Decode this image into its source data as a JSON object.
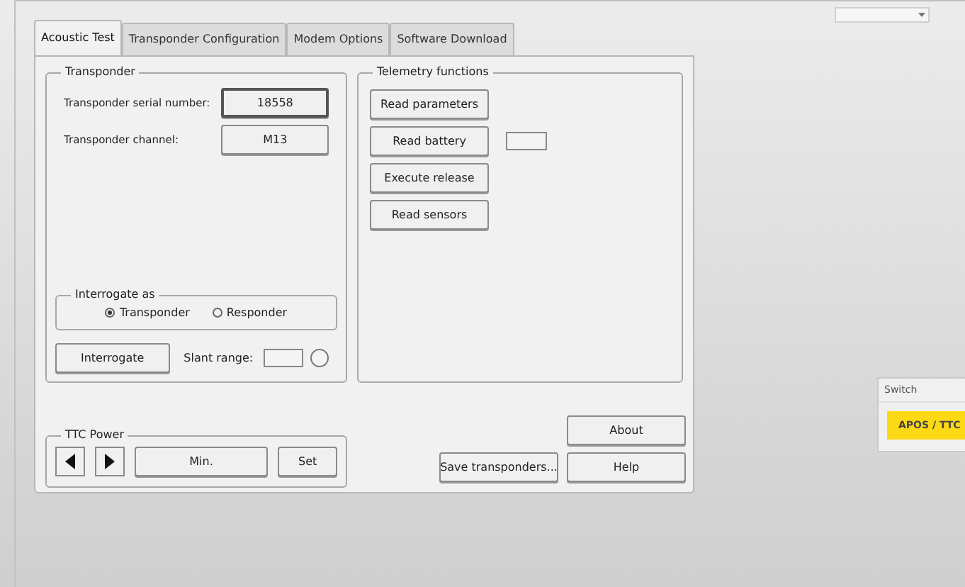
{
  "tabs": [
    {
      "label": "Acoustic Test",
      "selected": true
    },
    {
      "label": "Transponder Configuration",
      "selected": false
    },
    {
      "label": "Modem Options",
      "selected": false
    },
    {
      "label": "Software Download",
      "selected": false
    }
  ],
  "transponder": {
    "title": "Transponder",
    "fields": [
      {
        "label": "Transponder serial number:",
        "value": "18558",
        "focused": true
      },
      {
        "label": "Transponder channel:",
        "value": "M13",
        "focused": false
      }
    ]
  },
  "interrogate_as": {
    "title": "Interrogate as",
    "options": [
      {
        "label": "Transponder",
        "selected": true
      },
      {
        "label": "Responder",
        "selected": false
      }
    ]
  },
  "interrogate_button": "Interrogate",
  "slant_range": {
    "label": "Slant range:"
  },
  "telemetry": {
    "title": "Telemetry functions",
    "buttons": [
      {
        "label": "Read parameters",
        "kind": "button"
      },
      {
        "label": "Read battery",
        "kind": "button_with_output"
      },
      {
        "label": "Execute release",
        "kind": "button"
      },
      {
        "label": "Read sensors",
        "kind": "button"
      }
    ]
  },
  "ttc_power": {
    "title": "TTC Power",
    "value": "Min.",
    "set": "Set"
  },
  "actions": {
    "save": "Save transponders...",
    "about": "About",
    "help": "Help"
  },
  "switch_panel": {
    "title": "Switch",
    "button": "APOS / TTC"
  }
}
